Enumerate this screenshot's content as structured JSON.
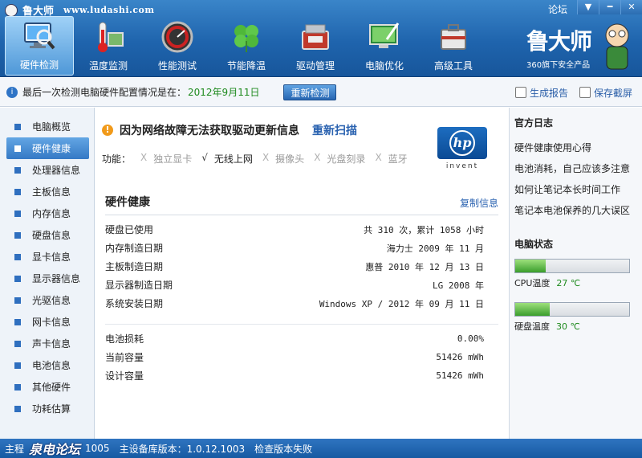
{
  "window": {
    "app_title": "鲁大师",
    "app_url": "www.ludashi.com",
    "forum_link": "论坛",
    "buttons": {
      "menu": "▼",
      "minimize": "━",
      "close": "✕"
    }
  },
  "toolbar": {
    "items": [
      {
        "label": "硬件检测",
        "icon": "monitor-magnifier-icon",
        "active": true
      },
      {
        "label": "温度监测",
        "icon": "thermometer-icon"
      },
      {
        "label": "性能测试",
        "icon": "gauge-icon"
      },
      {
        "label": "节能降温",
        "icon": "clover-icon"
      },
      {
        "label": "驱动管理",
        "icon": "toolbox-icon"
      },
      {
        "label": "电脑优化",
        "icon": "screen-wand-icon"
      },
      {
        "label": "高级工具",
        "icon": "toolcase-icon"
      }
    ]
  },
  "brand": {
    "name": "鲁大师",
    "subtitle": "360旗下安全产品"
  },
  "infobar": {
    "prefix": "最后一次检测电脑硬件配置情况是在：",
    "date": "2012年9月11日",
    "recheck": "重新检测",
    "report": "生成报告",
    "screenshot": "保存截屏"
  },
  "sidebar": {
    "items": [
      {
        "label": "电脑概览"
      },
      {
        "label": "硬件健康",
        "active": true
      },
      {
        "label": "处理器信息"
      },
      {
        "label": "主板信息"
      },
      {
        "label": "内存信息"
      },
      {
        "label": "硬盘信息"
      },
      {
        "label": "显卡信息"
      },
      {
        "label": "显示器信息"
      },
      {
        "label": "光驱信息"
      },
      {
        "label": "网卡信息"
      },
      {
        "label": "声卡信息"
      },
      {
        "label": "电池信息"
      },
      {
        "label": "其他硬件"
      },
      {
        "label": "功耗估算"
      }
    ]
  },
  "main": {
    "warning": "因为网络故障无法获取驱动更新信息",
    "rescan": "重新扫描",
    "features_label": "功能：",
    "features": [
      {
        "mark": "X",
        "label": "独立显卡",
        "on": false
      },
      {
        "mark": "√",
        "label": "无线上网",
        "on": true
      },
      {
        "mark": "X",
        "label": "摄像头",
        "on": false
      },
      {
        "mark": "X",
        "label": "光盘刻录",
        "on": false
      },
      {
        "mark": "X",
        "label": "蓝牙",
        "on": false
      }
    ],
    "vendor_logo": {
      "mark": "hp",
      "word": "invent"
    },
    "section_title": "硬件健康",
    "copy": "复制信息",
    "rows": [
      {
        "k": "硬盘已使用",
        "v": "共 310 次，累计 1058 小时"
      },
      {
        "k": "内存制造日期",
        "v": "海力士 2009 年 11 月"
      },
      {
        "k": "主板制造日期",
        "v": "惠普 2010 年 12 月 13 日"
      },
      {
        "k": "显示器制造日期",
        "v": "LG 2008 年"
      },
      {
        "k": "系统安装日期",
        "v": "Windows XP / 2012 年 09 月 11 日"
      }
    ],
    "rows2": [
      {
        "k": "电池损耗",
        "v": "0.00%"
      },
      {
        "k": "当前容量",
        "v": "51426 mWh"
      },
      {
        "k": "设计容量",
        "v": "51426 mWh"
      }
    ]
  },
  "right": {
    "log_title": "官方日志",
    "logs": [
      "硬件健康使用心得",
      "电池消耗，自己应该多注意",
      "如何让笔记本长时间工作",
      "笔记本电池保养的几大误区"
    ],
    "state_title": "电脑状态",
    "cpu": {
      "label": "CPU温度",
      "temp": "27 ℃",
      "level": 0.27
    },
    "disk": {
      "label": "硬盘温度",
      "temp": "30 ℃",
      "level": 0.3
    }
  },
  "status": {
    "left": "主程",
    "watermark": "泉电论坛",
    "ver_tail": "1005",
    "db_version": "主设备库版本：1.0.12.1003",
    "check": "检查版本失败"
  }
}
